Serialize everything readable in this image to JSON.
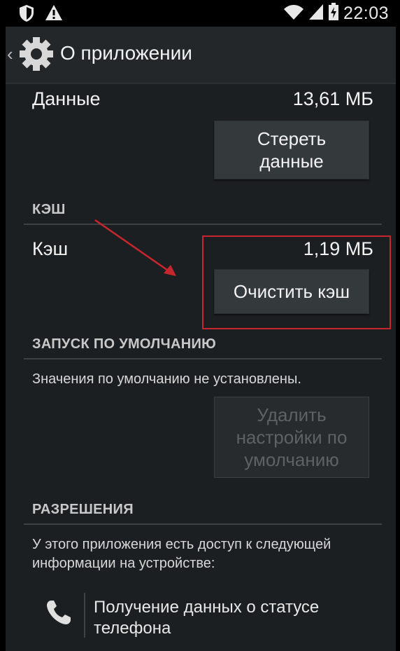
{
  "status_bar": {
    "time": "22:03",
    "icons": [
      "shield-icon",
      "warning-icon",
      "wifi-icon",
      "signal-icon",
      "battery-charging-icon"
    ]
  },
  "action_bar": {
    "title": "О приложении",
    "icon": "settings-gear-icon"
  },
  "storage": {
    "data_label": "Данные",
    "data_value": "13,61 МБ",
    "clear_data_button": "Стереть данные"
  },
  "cache": {
    "section_header": "КЭШ",
    "label": "Кэш",
    "value": "1,19 МБ",
    "clear_cache_button": "Очистить кэш"
  },
  "launch_default": {
    "section_header": "ЗАПУСК ПО УМОЛЧАНИЮ",
    "description": "Значения по умолчанию не установлены.",
    "clear_defaults_button": "Удалить настройки по умолчанию"
  },
  "permissions": {
    "section_header": "РАЗРЕШЕНИЯ",
    "description": "У этого приложения есть доступ к следующей информации на устройстве:",
    "items": [
      {
        "icon": "phone-icon",
        "label": "Получение данных о статусе телефона"
      }
    ]
  },
  "annotation": {
    "highlight_color": "#c8262e"
  }
}
